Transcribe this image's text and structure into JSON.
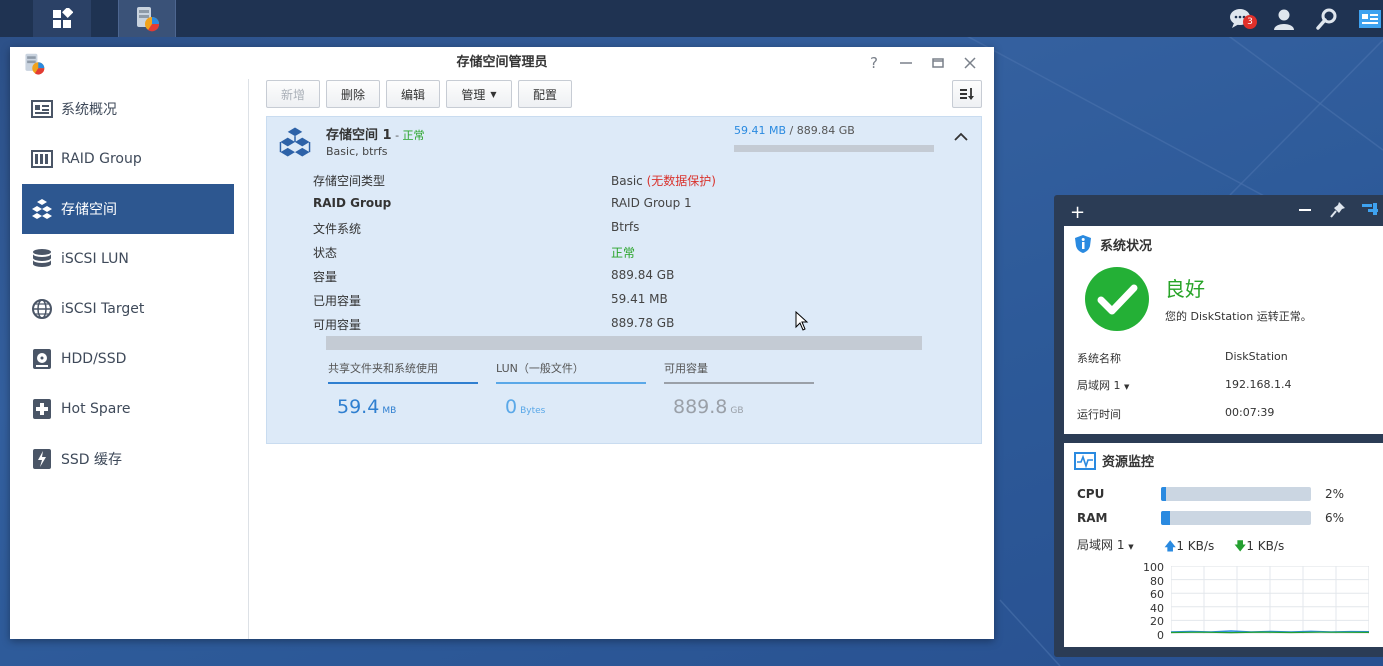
{
  "taskbar": {
    "chat_badge": "3"
  },
  "window": {
    "title": "存储空间管理员"
  },
  "sidebar": {
    "items": [
      {
        "label": "系统概况"
      },
      {
        "label": "RAID Group"
      },
      {
        "label": "存储空间"
      },
      {
        "label": "iSCSI LUN"
      },
      {
        "label": "iSCSI Target"
      },
      {
        "label": "HDD/SSD"
      },
      {
        "label": "Hot Spare"
      },
      {
        "label": "SSD 缓存"
      }
    ]
  },
  "toolbar": {
    "new": "新增",
    "delete": "删除",
    "edit": "编辑",
    "manage": "管理",
    "config": "配置"
  },
  "volume": {
    "name": "存储空间 1",
    "status_sep": " - ",
    "status": "正常",
    "subtitle": "Basic, btrfs",
    "used_top": "59.41 MB",
    "total_top": " / 889.84 GB",
    "usage_fraction": 0.0001,
    "details": [
      {
        "label": "存储空间类型",
        "value": "Basic",
        "extra": "(无数据保护)"
      },
      {
        "label": "RAID Group",
        "value": "RAID Group 1"
      },
      {
        "label": "文件系统",
        "value": "Btrfs"
      },
      {
        "label": "状态",
        "value": "正常"
      },
      {
        "label": "容量",
        "value": "889.84 GB"
      },
      {
        "label": "已用容量",
        "value": "59.41 MB"
      },
      {
        "label": "可用容量",
        "value": "889.78 GB"
      }
    ],
    "tabs": [
      {
        "label": "共享文件夹和系统使用",
        "value": "59.4",
        "unit": "MB",
        "color": "#2f7fd0"
      },
      {
        "label": "LUN（一般文件）",
        "value": "0",
        "unit": "Bytes",
        "color": "#5aa8e8"
      },
      {
        "label": "可用容量",
        "value": "889.8",
        "unit": "GB",
        "color": "#9aa0a8"
      }
    ]
  },
  "widget": {
    "status": {
      "title": "系统状况",
      "state": "良好",
      "message": "您的 DiskStation 运转正常。",
      "rows": [
        {
          "label": "系统名称",
          "value": "DiskStation"
        },
        {
          "label": "局域网 1",
          "value": "192.168.1.4"
        },
        {
          "label": "运行时间",
          "value": "00:07:39"
        }
      ]
    },
    "resource": {
      "title": "资源监控",
      "cpu_label": "CPU",
      "cpu_value": "2%",
      "cpu": 0.02,
      "ram_label": "RAM",
      "ram_value": "6%",
      "ram": 0.06,
      "lan_label": "局域网 1",
      "up": "1 KB/s",
      "down": "1 KB/s",
      "axis": [
        "100",
        "80",
        "60",
        "40",
        "20",
        "0"
      ]
    }
  }
}
